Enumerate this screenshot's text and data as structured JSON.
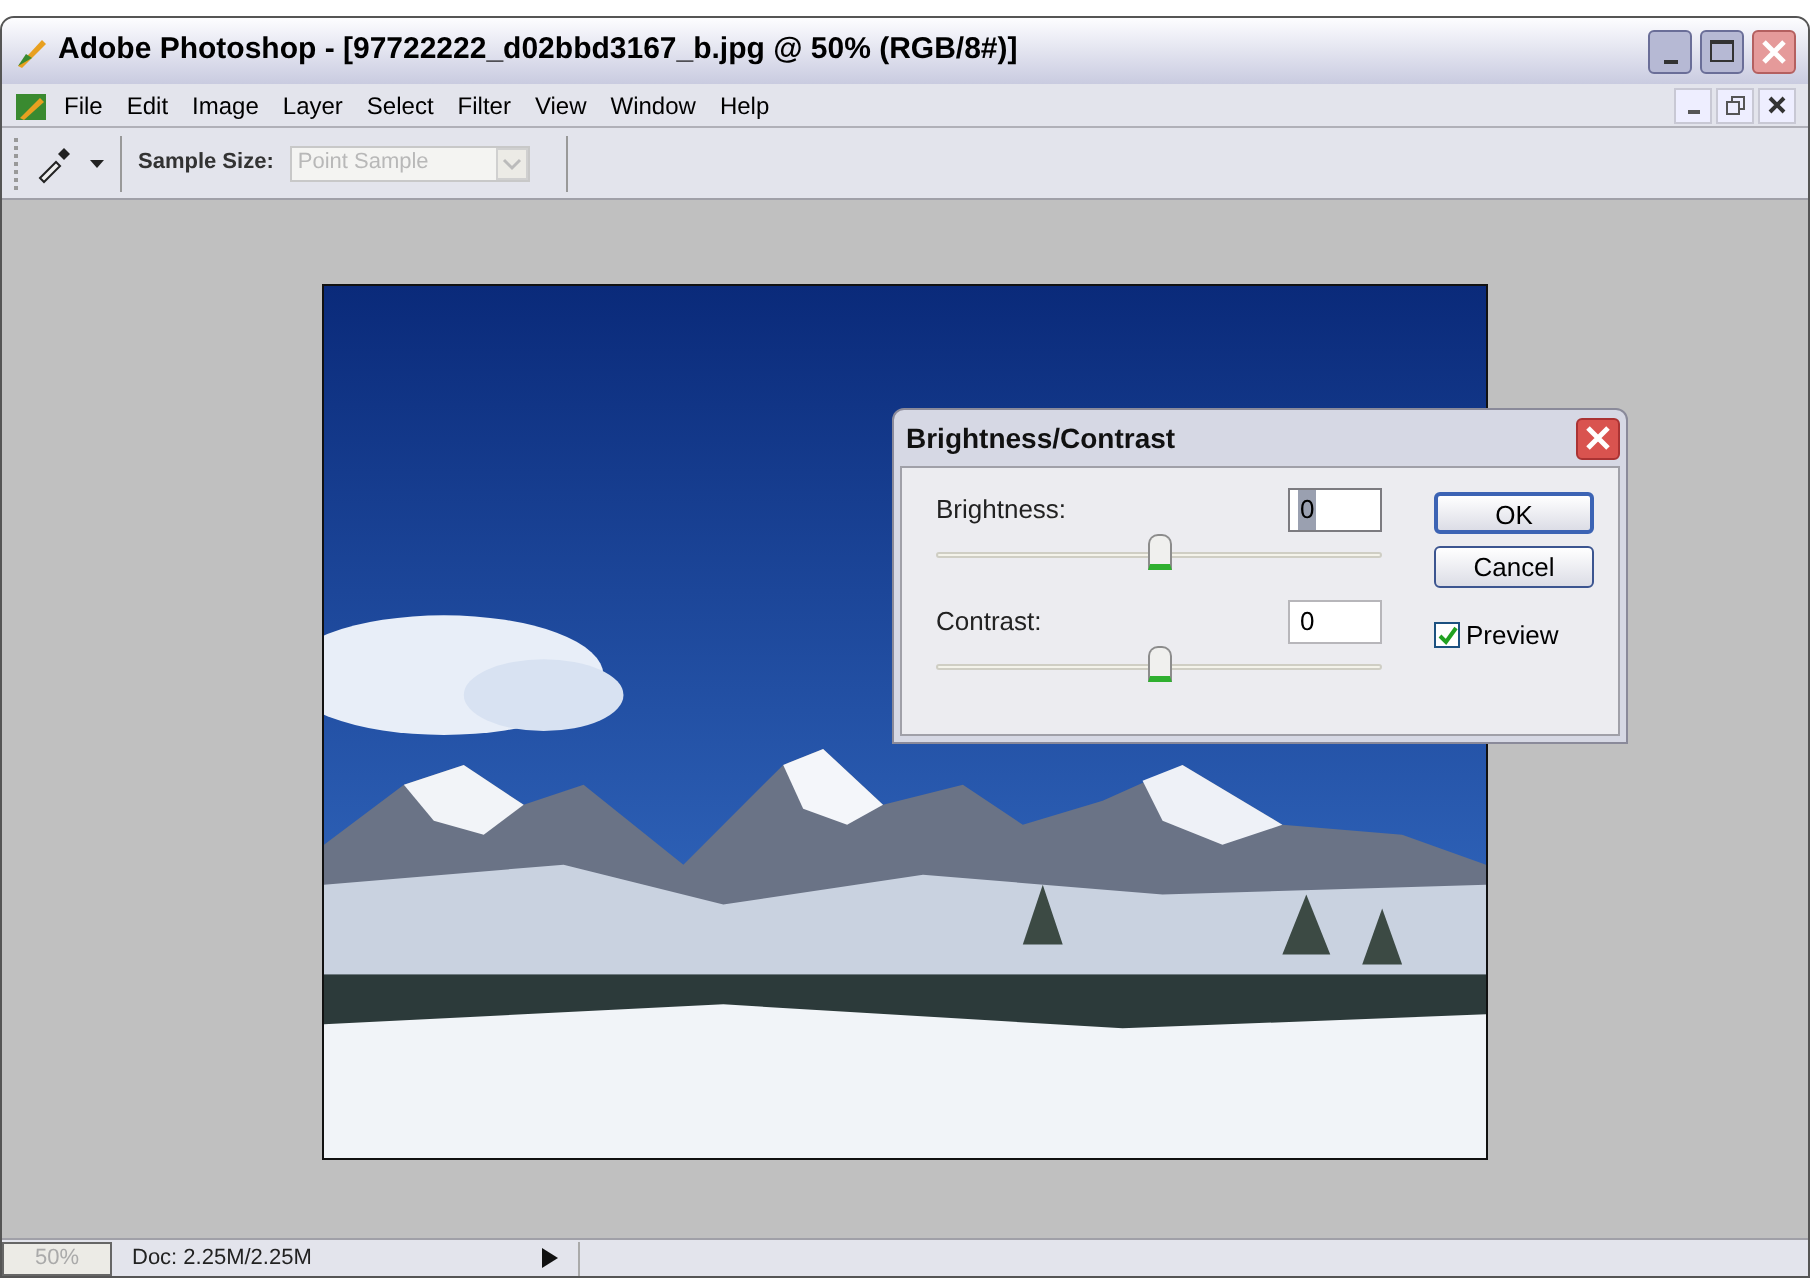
{
  "window": {
    "title": "Adobe Photoshop - [97722222_d02bbd3167_b.jpg @ 50% (RGB/8#)]"
  },
  "menu": [
    "File",
    "Edit",
    "Image",
    "Layer",
    "Select",
    "Filter",
    "View",
    "Window",
    "Help"
  ],
  "options_bar": {
    "sample_size_label": "Sample Size:",
    "sample_size_value": "Point Sample",
    "disabled": true
  },
  "dialog": {
    "title": "Brightness/Contrast",
    "sliders": [
      {
        "label": "Brightness:",
        "value": "0",
        "level": 0.5,
        "selected": true
      },
      {
        "label": "Contrast:",
        "value": "0",
        "level": 0.5,
        "selected": false
      }
    ],
    "buttons": [
      "OK",
      "Cancel"
    ],
    "preview": {
      "label": "Preview",
      "checked": true
    }
  },
  "status_bar": {
    "zoom": "50%",
    "doc": "Doc: 2.25M/2.25M"
  }
}
